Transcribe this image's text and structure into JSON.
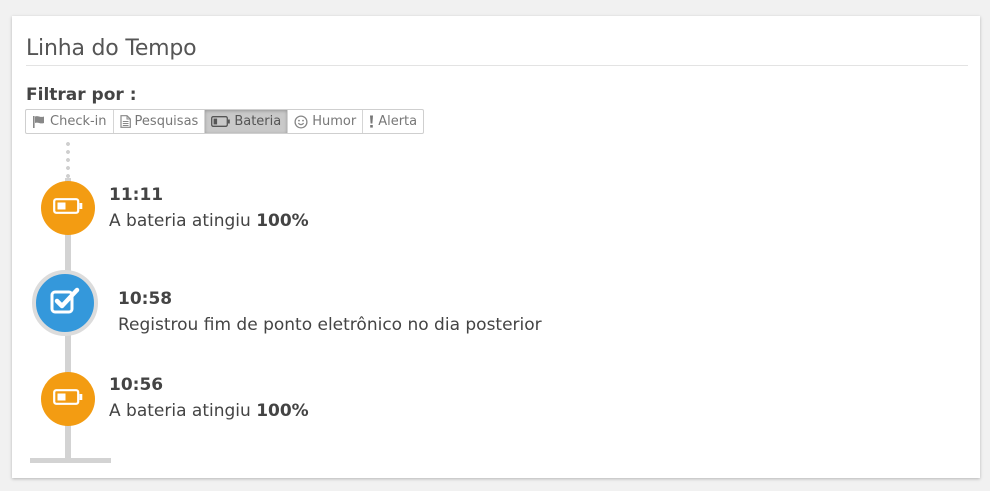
{
  "card": {
    "title": "Linha do Tempo",
    "filter_label": "Filtrar por :"
  },
  "filters": [
    {
      "label": "Check-in",
      "icon": "flag-icon",
      "active": false
    },
    {
      "label": "Pesquisas",
      "icon": "document-icon",
      "active": false
    },
    {
      "label": "Bateria",
      "icon": "battery-icon",
      "active": true
    },
    {
      "label": "Humor",
      "icon": "smiley-icon",
      "active": false
    },
    {
      "label": "Alerta",
      "icon": "exclamation-icon",
      "active": false
    }
  ],
  "timeline": [
    {
      "time": "11:11",
      "text": "A bateria atingiu ",
      "value": "100%",
      "icon": "battery-icon",
      "color": "#f39c12"
    },
    {
      "time": "10:58",
      "text": "Registrou fim de ponto eletrônico no dia posterior",
      "icon": "checkbox-icon",
      "color": "#3498db"
    },
    {
      "time": "10:56",
      "text": "A bateria atingiu ",
      "value": "100%",
      "icon": "battery-icon",
      "color": "#f39c12"
    }
  ]
}
